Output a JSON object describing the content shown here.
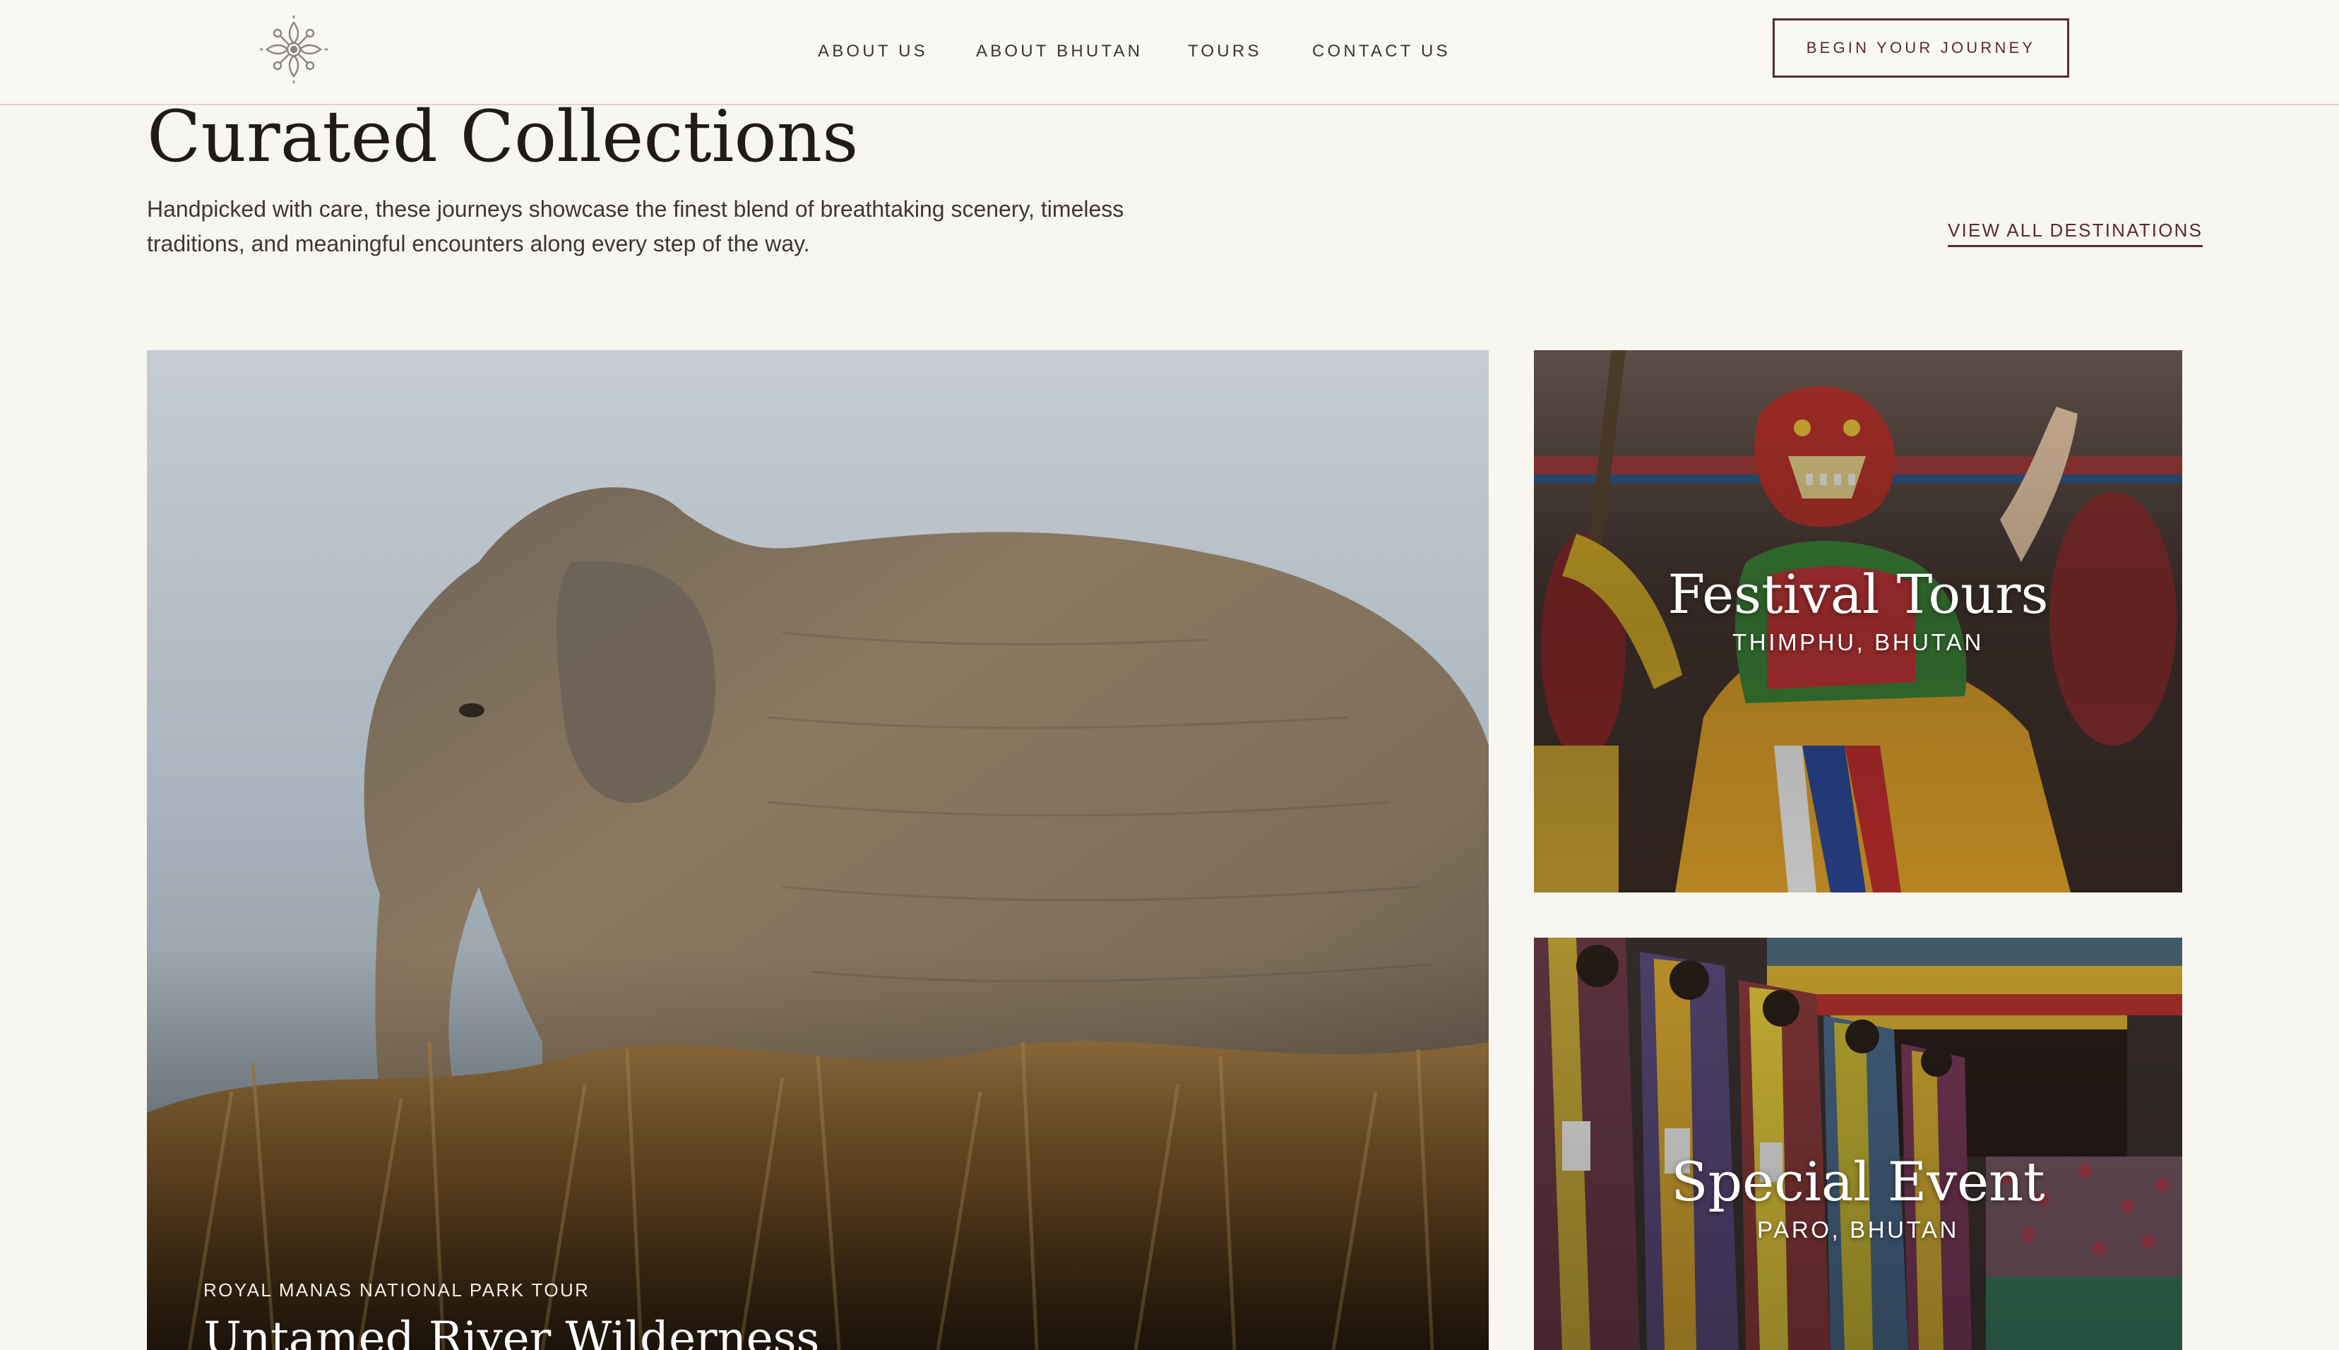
{
  "header": {
    "logo_icon": "dorje-emblem-icon",
    "nav": [
      {
        "label": "ABOUT US"
      },
      {
        "label": "ABOUT BHUTAN"
      },
      {
        "label": "TOURS"
      },
      {
        "label": "CONTACT US"
      }
    ],
    "cta_label": "BEGIN YOUR JOURNEY"
  },
  "intro": {
    "title": "Curated Collections",
    "description": "Handpicked with care, these journeys showcase the finest blend of breathtaking scenery, timeless traditions, and meaningful encounters along every step of the way.",
    "view_all_label": "VIEW ALL DESTINATIONS"
  },
  "cards": {
    "featured": {
      "eyebrow": "ROYAL MANAS NATIONAL PARK TOUR",
      "title": "Untamed River Wilderness",
      "image": "elephant-in-grassland"
    },
    "festival": {
      "title": "Festival Tours",
      "location": "THIMPHU, BHUTAN",
      "image": "masked-dancer-festival"
    },
    "event": {
      "title": "Special Event",
      "location": "PARO, BHUTAN",
      "image": "dancers-in-procession"
    }
  },
  "colors": {
    "background": "#f8f6f1",
    "accent": "#5a2a30",
    "text": "#2b2624",
    "header_border": "#e6cfcf"
  }
}
